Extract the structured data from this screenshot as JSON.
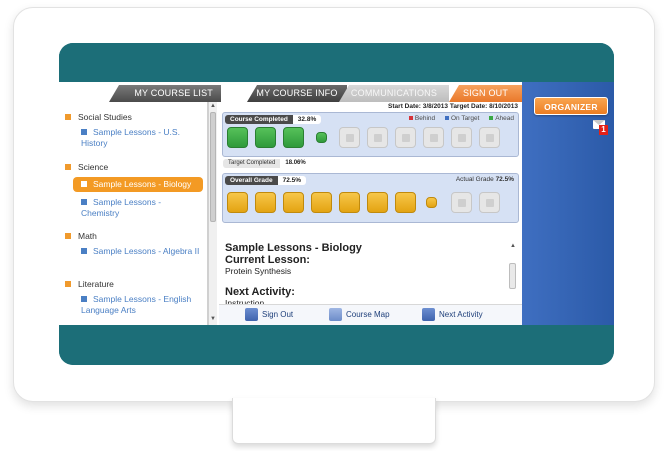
{
  "nav": {
    "course_list": "MY COURSE LIST",
    "course_info": "MY COURSE INFO",
    "communications": "COMMUNICATIONS",
    "sign_out": "SIGN OUT"
  },
  "side": {
    "organizer": "ORGANIZER",
    "mail_count": "1"
  },
  "dates": {
    "text": "Start Date: 3/8/2013  Target Date: 8/10/2013"
  },
  "sidebar": {
    "subjects": [
      {
        "name": "Social Studies",
        "lesson": "Sample Lessons - U.S. History"
      },
      {
        "name": "Science",
        "lesson": "Sample Lessons - Biology",
        "lesson2": "Sample Lessons - Chemistry"
      },
      {
        "name": "Math",
        "lesson": "Sample Lessons - Algebra II"
      },
      {
        "name": "Literature",
        "lesson": "Sample Lessons - English Language Arts"
      }
    ]
  },
  "progress": {
    "completed_label": "Course Completed",
    "completed_value": "32.8%",
    "legend": [
      "Behind",
      "On Target",
      "Ahead"
    ],
    "target_label": "Target Completed",
    "target_value": "18.06%",
    "grade_label": "Overall Grade",
    "grade_value": "72.5%",
    "actual_label": "Actual Grade",
    "actual_value": "72.5%"
  },
  "info": {
    "course_title": "Sample Lessons - Biology",
    "current_label": "Current Lesson:",
    "current_value": "Protein Synthesis",
    "next_label": "Next Activity:",
    "next_value": "Instruction"
  },
  "footer": {
    "sign_out": "Sign Out",
    "course_map": "Course Map",
    "next_activity": "Next Activity"
  },
  "colors": {
    "teal": "#1c6e78",
    "orange": "#f39a24",
    "blue_panel": "#3f6fc1",
    "link_blue": "#4a7fc4"
  }
}
